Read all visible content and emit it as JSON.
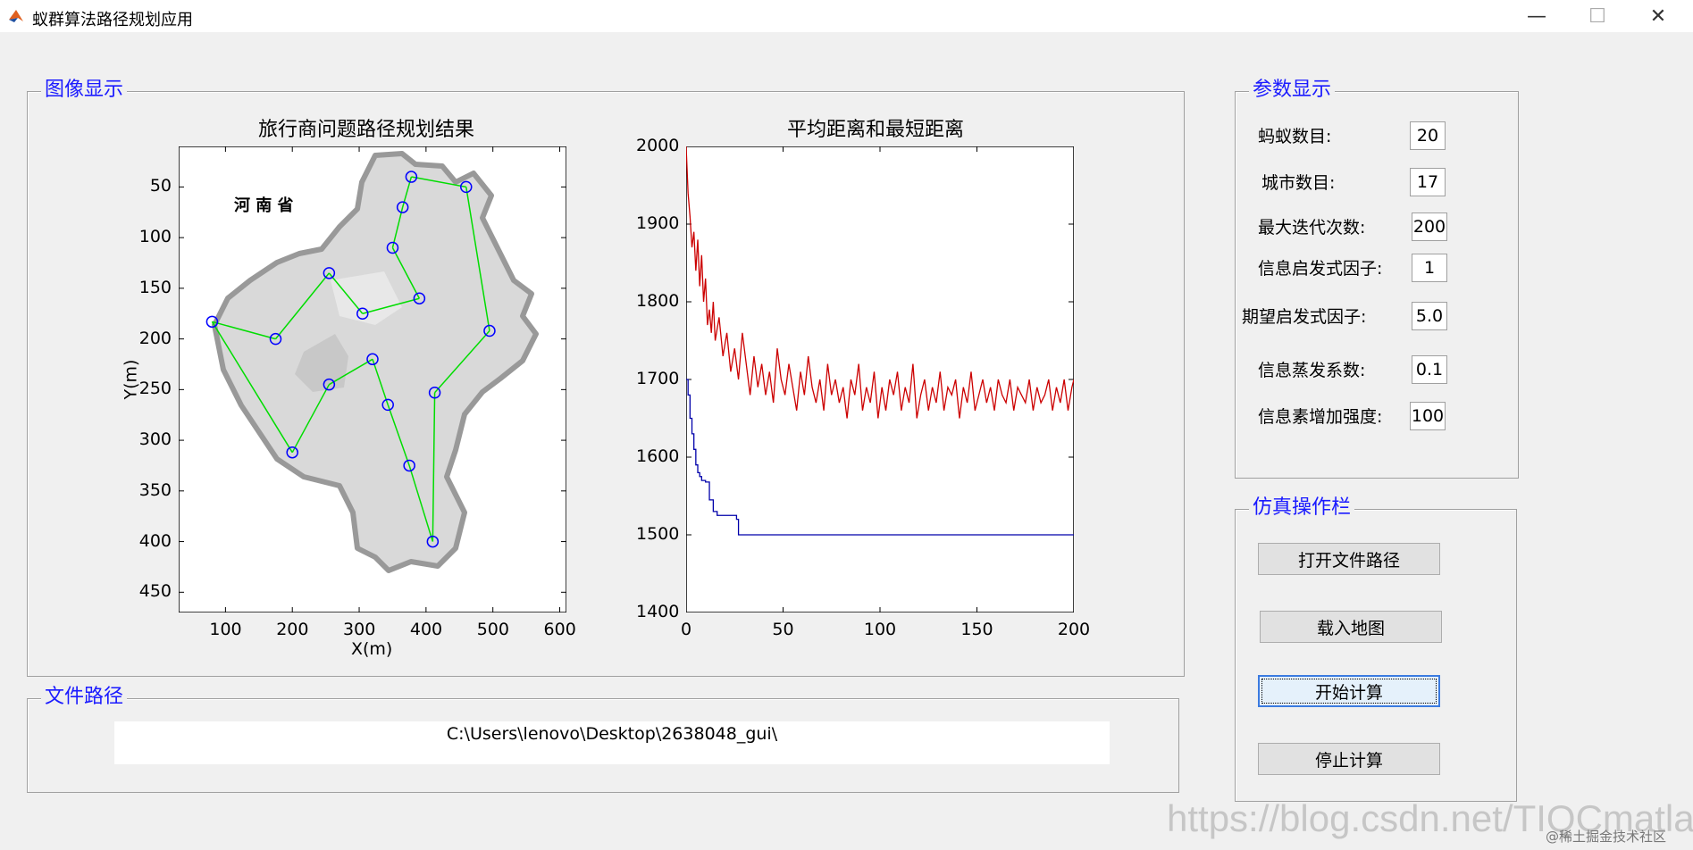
{
  "window": {
    "title": "蚁群算法路径规划应用",
    "minimize_glyph": "—",
    "maximize_glyph": "☐",
    "close_glyph": "✕"
  },
  "image_panel": {
    "title": "图像显示",
    "map_plot": {
      "title": "旅行商问题路径规划结果",
      "xlabel": "X(m)",
      "ylabel": "Y(m)",
      "map_label": "河 南 省",
      "x_ticks": [
        "100",
        "200",
        "300",
        "400",
        "500",
        "600"
      ],
      "y_ticks": [
        "50",
        "100",
        "150",
        "200",
        "250",
        "300",
        "350",
        "400",
        "450"
      ]
    },
    "distance_plot": {
      "title": "平均距离和最短距离",
      "x_ticks": [
        "0",
        "50",
        "100",
        "150",
        "200"
      ],
      "y_ticks": [
        "2000",
        "1900",
        "1800",
        "1700",
        "1600",
        "1500",
        "1400"
      ]
    }
  },
  "chart_data": [
    {
      "type": "scatter",
      "title": "旅行商问题路径规划结果",
      "xlabel": "X(m)",
      "ylabel": "Y(m)",
      "xlim": [
        30,
        610
      ],
      "ylim": [
        470,
        10
      ],
      "cities": [
        [
          378,
          40
        ],
        [
          460,
          50
        ],
        [
          365,
          70
        ],
        [
          350,
          110
        ],
        [
          255,
          135
        ],
        [
          390,
          160
        ],
        [
          305,
          175
        ],
        [
          80,
          183
        ],
        [
          175,
          200
        ],
        [
          495,
          192
        ],
        [
          320,
          220
        ],
        [
          255,
          245
        ],
        [
          343,
          265
        ],
        [
          413,
          253
        ],
        [
          200,
          312
        ],
        [
          375,
          325
        ],
        [
          410,
          400
        ]
      ],
      "route_order": [
        0,
        2,
        3,
        5,
        6,
        4,
        8,
        7,
        14,
        11,
        10,
        12,
        15,
        16,
        13,
        9,
        1,
        0
      ]
    },
    {
      "type": "line",
      "title": "平均距离和最短距离",
      "xlim": [
        0,
        200
      ],
      "ylim": [
        1400,
        2000
      ],
      "series": [
        {
          "color": "#cc0000",
          "x": [
            0,
            1,
            2,
            3,
            4,
            5,
            6,
            7,
            8,
            9,
            10,
            11,
            12,
            13,
            14,
            15,
            17,
            19,
            21,
            23,
            25,
            27,
            29,
            31,
            33,
            35,
            37,
            39,
            41,
            43,
            45,
            47,
            49,
            51,
            53,
            55,
            57,
            59,
            61,
            63,
            65,
            67,
            69,
            71,
            73,
            75,
            77,
            79,
            81,
            83,
            85,
            87,
            89,
            91,
            93,
            95,
            97,
            99,
            101,
            103,
            105,
            107,
            109,
            111,
            113,
            115,
            117,
            119,
            121,
            123,
            125,
            127,
            129,
            131,
            133,
            135,
            137,
            139,
            141,
            143,
            145,
            147,
            149,
            151,
            153,
            155,
            157,
            159,
            161,
            163,
            165,
            167,
            169,
            171,
            173,
            175,
            177,
            179,
            181,
            183,
            185,
            187,
            189,
            191,
            193,
            195,
            197,
            199,
            200
          ],
          "values": [
            2000,
            1940,
            1910,
            1870,
            1890,
            1840,
            1880,
            1820,
            1860,
            1800,
            1830,
            1770,
            1790,
            1760,
            1800,
            1750,
            1780,
            1730,
            1760,
            1710,
            1740,
            1700,
            1760,
            1720,
            1680,
            1730,
            1690,
            1720,
            1680,
            1710,
            1670,
            1740,
            1700,
            1680,
            1720,
            1690,
            1660,
            1710,
            1680,
            1730,
            1690,
            1670,
            1700,
            1660,
            1720,
            1680,
            1700,
            1670,
            1690,
            1650,
            1700,
            1680,
            1720,
            1660,
            1690,
            1670,
            1710,
            1650,
            1690,
            1660,
            1700,
            1680,
            1710,
            1660,
            1690,
            1670,
            1720,
            1650,
            1680,
            1700,
            1660,
            1690,
            1670,
            1710,
            1660,
            1690,
            1680,
            1700,
            1650,
            1690,
            1670,
            1710,
            1660,
            1680,
            1700,
            1670,
            1690,
            1660,
            1700,
            1680,
            1670,
            1700,
            1660,
            1690,
            1680,
            1670,
            1700,
            1660,
            1690,
            1670,
            1680,
            1700,
            1660,
            1690,
            1670,
            1700,
            1660,
            1690,
            1700
          ]
        },
        {
          "color": "#0000aa",
          "x": [
            0,
            1,
            2,
            3,
            4,
            5,
            6,
            7,
            8,
            10,
            12,
            14,
            16,
            20,
            24,
            26,
            27,
            30,
            40,
            60,
            100,
            150,
            200
          ],
          "values": [
            1700,
            1680,
            1650,
            1630,
            1610,
            1590,
            1580,
            1575,
            1570,
            1568,
            1545,
            1530,
            1525,
            1525,
            1525,
            1520,
            1500,
            1500,
            1500,
            1500,
            1500,
            1500,
            1500
          ]
        }
      ]
    }
  ],
  "file_panel": {
    "title": "文件路径",
    "path": "C:\\Users\\lenovo\\Desktop\\2638048_gui\\"
  },
  "params_panel": {
    "title": "参数显示",
    "items": [
      {
        "label": "蚂蚁数目:",
        "value": "20"
      },
      {
        "label": "城市数目:",
        "value": "17"
      },
      {
        "label": "最大迭代次数:",
        "value": "200"
      },
      {
        "label": "信息启发式因子:",
        "value": "1"
      },
      {
        "label": "期望启发式因子:",
        "value": "5.0"
      },
      {
        "label": "信息蒸发系数:",
        "value": "0.1"
      },
      {
        "label": "信息素增加强度:",
        "value": "100"
      }
    ]
  },
  "sim_panel": {
    "title": "仿真操作栏",
    "buttons": [
      {
        "label": "打开文件路径"
      },
      {
        "label": "载入地图"
      },
      {
        "label": "开始计算"
      },
      {
        "label": "停止计算"
      }
    ]
  },
  "watermark": {
    "text": "https://blog.csdn.net/TIQCmatlab",
    "secondary": "@稀土掘金技术社区"
  }
}
